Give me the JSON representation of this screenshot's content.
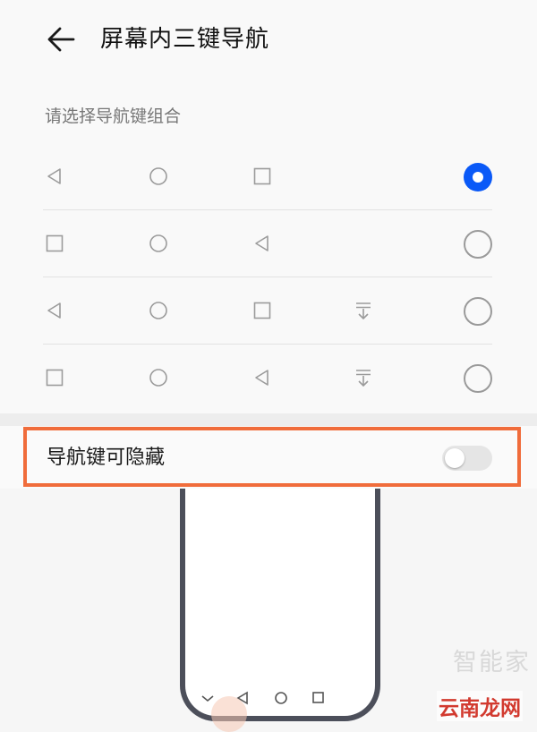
{
  "header": {
    "title": "屏幕内三键导航"
  },
  "section": {
    "subtitle": "请选择导航键组合"
  },
  "options": [
    {
      "icons": [
        "back-icon",
        "home-icon",
        "recent-icon"
      ],
      "selected": true
    },
    {
      "icons": [
        "recent-icon",
        "home-icon",
        "back-icon"
      ],
      "selected": false
    },
    {
      "icons": [
        "back-icon",
        "home-icon",
        "recent-icon",
        "notification-pulldown-icon"
      ],
      "selected": false
    },
    {
      "icons": [
        "recent-icon",
        "home-icon",
        "back-icon",
        "notification-pulldown-icon"
      ],
      "selected": false
    }
  ],
  "hide_nav": {
    "label": "导航键可隐藏",
    "enabled": false
  },
  "watermark": {
    "brand": "智能家",
    "site": "云南龙网"
  },
  "colors": {
    "accent": "#0a59f7",
    "highlight": "#f06c3b",
    "phone_frame": "#4c4f5a"
  }
}
